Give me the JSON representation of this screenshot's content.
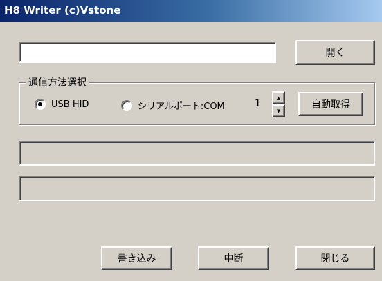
{
  "window": {
    "title": "H8 Writer (c)Vstone"
  },
  "file": {
    "path_value": "",
    "open_label": "開く"
  },
  "comm": {
    "group_label": "通信方法選択",
    "options": [
      {
        "label": "USB HID",
        "checked": true
      },
      {
        "label": "シリアルポート:COM",
        "checked": false
      }
    ],
    "com_number": "1",
    "spin_up_icon": "up-arrow-icon",
    "spin_down_icon": "down-arrow-icon",
    "auto_detect_label": "自動取得"
  },
  "progress": {
    "bar1_fraction": 0,
    "bar2_fraction": 0
  },
  "buttons": {
    "write_label": "書き込み",
    "abort_label": "中断",
    "close_label": "閉じる"
  },
  "colors": {
    "title_gradient_start": "#0a246a",
    "title_gradient_end": "#a6caf0",
    "face": "#d4d0c8"
  }
}
